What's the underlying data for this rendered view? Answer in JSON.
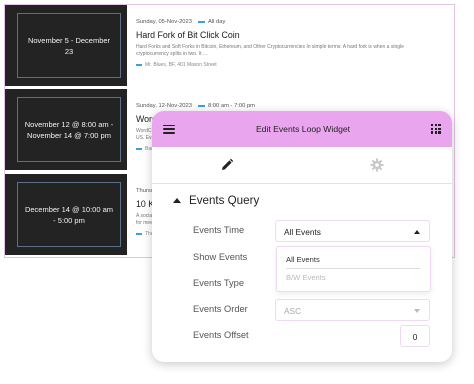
{
  "events": [
    {
      "date_range": "November 5 - December 23",
      "meta_date": "Sunday, 05-Nov-2023",
      "meta_time": "All day",
      "title": "Hard Fork of Bit Click Coin",
      "description": "Hard Forks and Soft Forks in Bitcoin, Ethereum, and Other Cryptocurrencies In simple terms: A hard fork is when a single cryptocurrency splits in two. It ...",
      "location": "Mr. Blues, BF, 401 Mason Street"
    },
    {
      "date_range": "November 12 @ 8:00 am - November 14 @ 7:00 pm",
      "meta_date": "Sunday, 12-Nov-2023",
      "meta_time": "8:00 am - 7:00 pm",
      "title": "Word",
      "description": "WordC...\nUS. Ev...",
      "location": "Ban..."
    },
    {
      "date_range": "December 14 @ 10:00 am - 5:00 pm",
      "meta_date": "Thursd...",
      "meta_time": "",
      "title": "10 K",
      "description": "A socia...\nfor mee...",
      "location": "The..."
    }
  ],
  "widget": {
    "title": "Edit Events Loop Widget",
    "tabs": [
      {
        "icon": "pencil-icon"
      },
      {
        "icon": "gear-icon"
      }
    ],
    "section_title": "Events Query",
    "fields": {
      "events_time": {
        "label": "Events Time",
        "value": "All Events"
      },
      "show_events": {
        "label": "Show Events"
      },
      "events_type": {
        "label": "Events Type"
      },
      "events_order": {
        "label": "Events Order",
        "value": "ASC"
      },
      "events_offset": {
        "label": "Events Offset",
        "value": "0"
      }
    },
    "dropdown_options": [
      "All Events",
      "B/W Events"
    ]
  },
  "colors": {
    "header_bg": "#e9a6ee",
    "accent_blue": "#3ba0e0",
    "thumb_bg": "#232323",
    "field_border": "#f0d9f2"
  }
}
